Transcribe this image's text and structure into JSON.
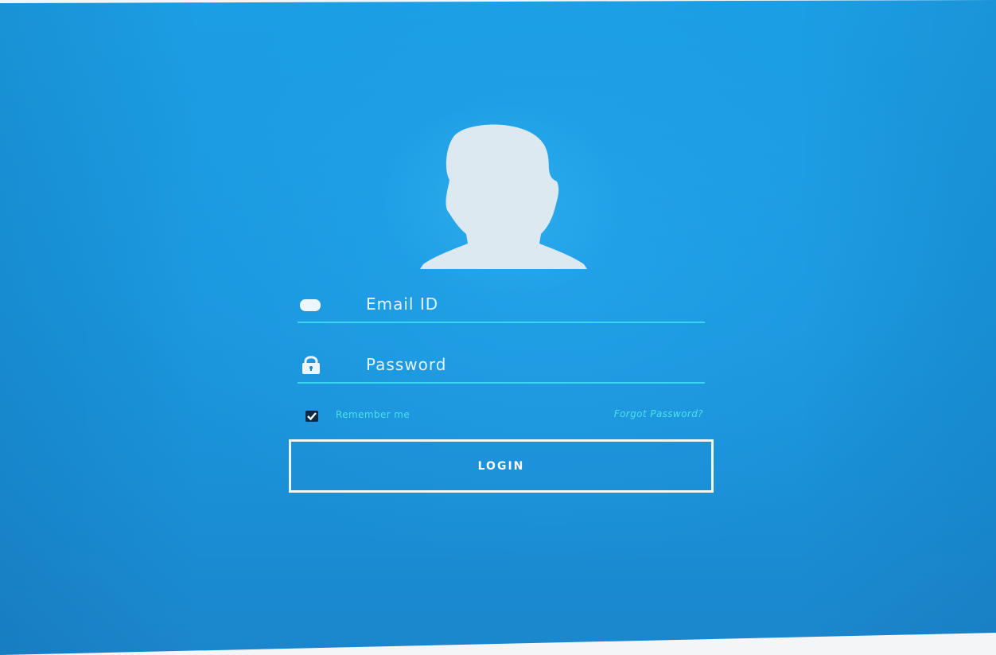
{
  "login_form": {
    "avatar_icon": "user-silhouette-icon",
    "email": {
      "icon": "envelope-icon",
      "placeholder": "Email ID",
      "value": ""
    },
    "password": {
      "icon": "lock-icon",
      "placeholder": "Password",
      "value": ""
    },
    "remember_me": {
      "label": "Remember me",
      "checked": true
    },
    "forgot_password_label": "Forgot Password?",
    "login_label": "LOGIN"
  },
  "colors": {
    "background": "#1b98df",
    "underline": "#39d4f0",
    "link_text": "#4fe0ea",
    "button_border": "#eef8ff",
    "checkbox_fill": "#0d2b44"
  }
}
